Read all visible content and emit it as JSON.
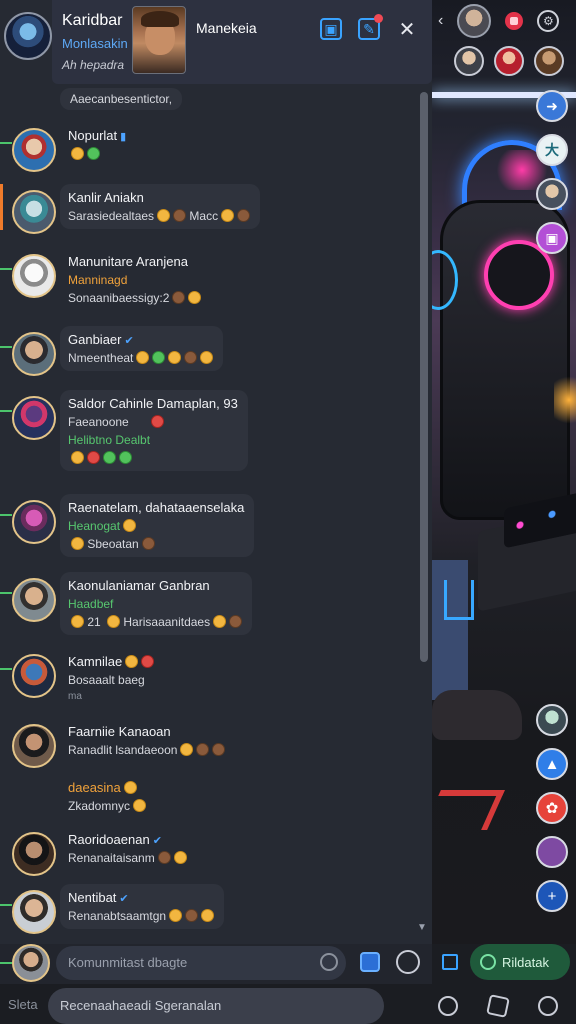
{
  "header": {
    "title": "Karidbar",
    "subtitle": "Monlasakin",
    "subtitle2": "Ah hepadra",
    "peer_name": "Manekeia"
  },
  "messages": [
    {
      "name": "",
      "sub": "Aaecanbesentictor,"
    },
    {
      "name": "Nopurlat",
      "sub": ""
    },
    {
      "name": "Kanlir Aniakn",
      "sub": "Sarasiedealtaes",
      "tail": "Macc"
    },
    {
      "name": "Manunitare Aranjena",
      "sub": "Manninagd",
      "line3": "Sonaanibaessigy:2"
    },
    {
      "name": "Ganbiaer",
      "sub": "Nmeentheat"
    },
    {
      "name": "Saldor Cahinle Damaplan, 93",
      "sub": "Faeanoone",
      "line3": "Helibtno Dealbt"
    },
    {
      "name": "Raenatelam, dahataaenselaka",
      "sub": "Heanogat",
      "line3": "Sbeoatan"
    },
    {
      "name": "Kaonulaniamar Ganbran",
      "sub": "Haadbef",
      "line3": "21",
      "tail": "Harisaaanitdaes"
    },
    {
      "name": "Kamnilae",
      "sub": "Bosaaalt baeg",
      "line3": "ma"
    },
    {
      "name": "Faarniie Kanaoan",
      "sub": "Ranadlit lsandaeoon"
    },
    {
      "name": "daeasina",
      "sub": "Zkadomnyc"
    },
    {
      "name": "Raoridoaenan",
      "sub": "Renanaitaisanm"
    },
    {
      "name": "Nentibat",
      "sub": "Renanabtsaamtgn"
    }
  ],
  "composer": {
    "placeholder": "Komunmitast dbagte"
  },
  "right_action": {
    "label": "Rildatak"
  },
  "bottom": {
    "label": "Sleta",
    "search_text": "Recenaahaeadi Sgeranalan"
  },
  "colors": {
    "accent_blue": "#3aa3ff",
    "online_green": "#4cc46c",
    "alert_orange": "#ef7b2b",
    "rec_red": "#e3334a"
  }
}
